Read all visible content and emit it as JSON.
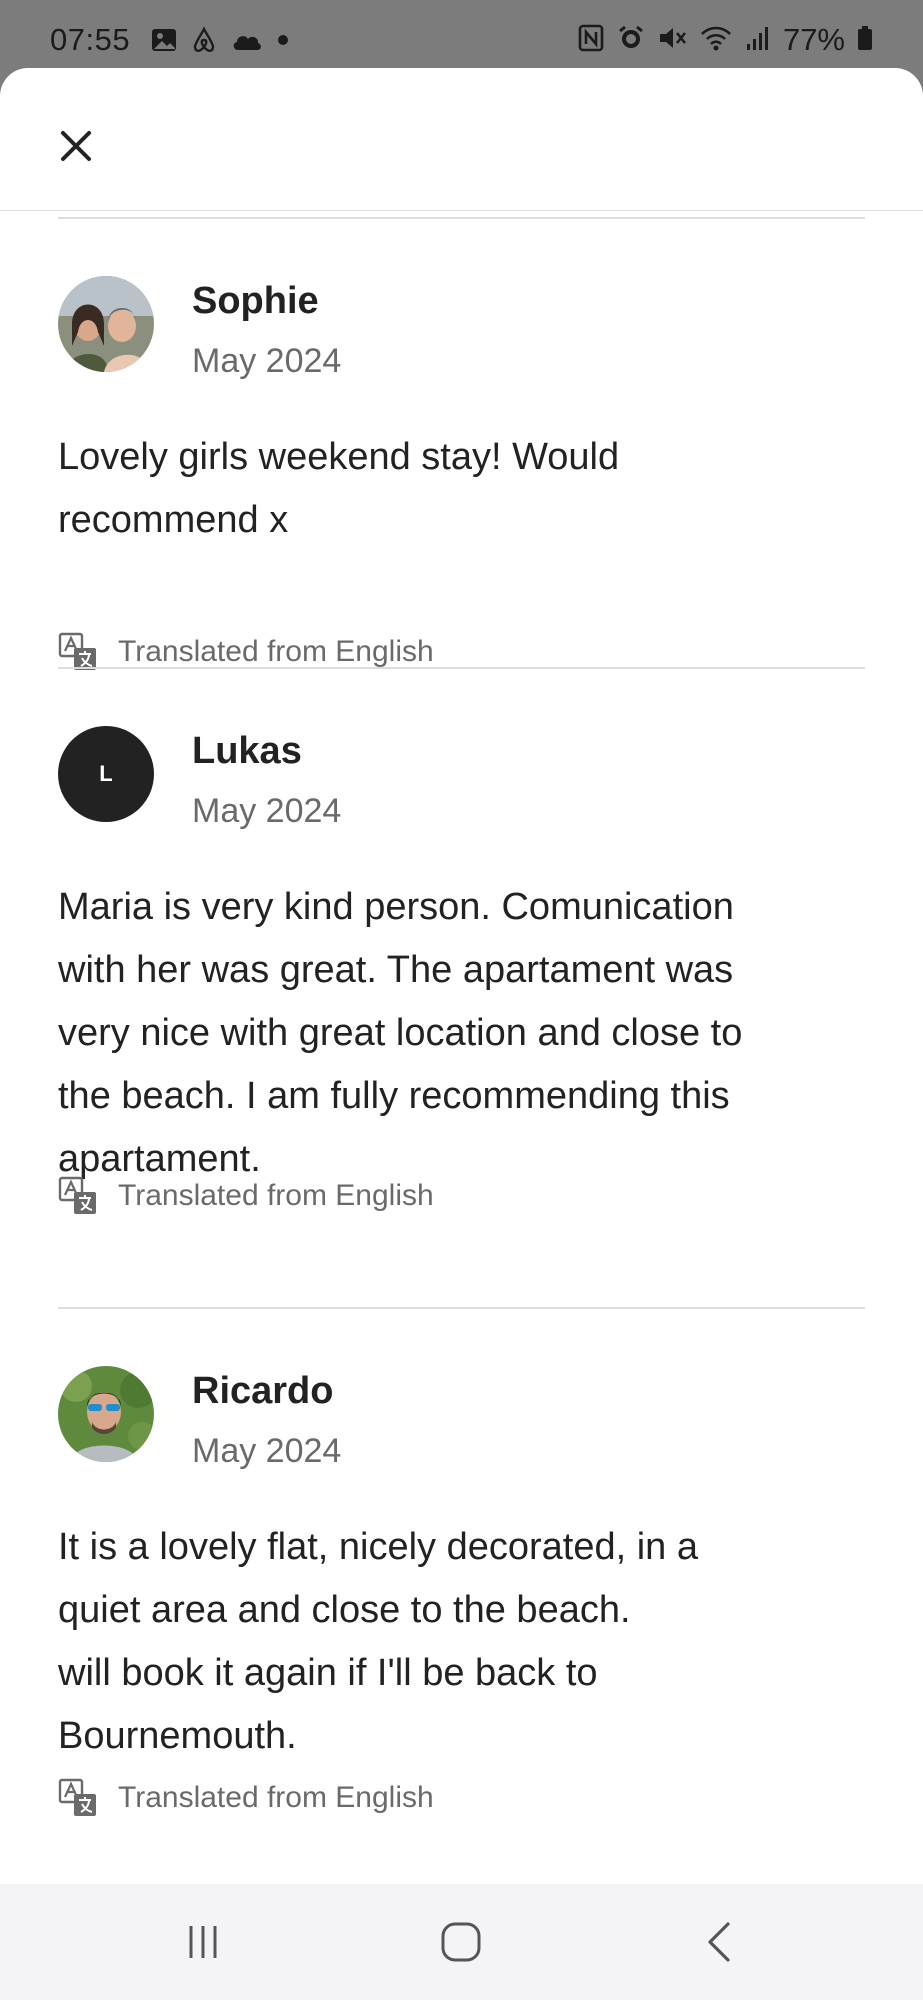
{
  "status_bar": {
    "time": "07:55",
    "battery": "77%",
    "left_icons": [
      "image-icon",
      "airbnb-icon",
      "cloud-icon",
      "dot-icon"
    ],
    "right_icons": [
      "nfc-icon",
      "alarm-icon",
      "mute-icon",
      "wifi-icon",
      "signal-icon",
      "battery-icon"
    ]
  },
  "header": {
    "close_icon": "close-icon"
  },
  "reviews": [
    {
      "name": "Sophie",
      "date": "May 2024",
      "avatar": "photo",
      "text": "Lovely girls weekend stay! Would\nrecommend x",
      "translated": "Translated from English"
    },
    {
      "name": "Lukas",
      "date": "May 2024",
      "avatar_letter": "L",
      "text": "Maria is very kind person. Comunication\nwith her was great. The apartament was\nvery nice with great location and close to\nthe beach. I am fully recommending this\napartament.",
      "translated": "Translated from English"
    },
    {
      "name": "Ricardo",
      "date": "May 2024",
      "avatar": "photo",
      "text": "It is a lovely flat, nicely decorated, in a\nquiet area and close to the beach.\nwill book it again if I'll be back to\nBournemouth.",
      "translated": "Translated from English"
    }
  ],
  "nav_bar": {
    "buttons": [
      "recents-icon",
      "home-icon",
      "back-icon"
    ]
  }
}
